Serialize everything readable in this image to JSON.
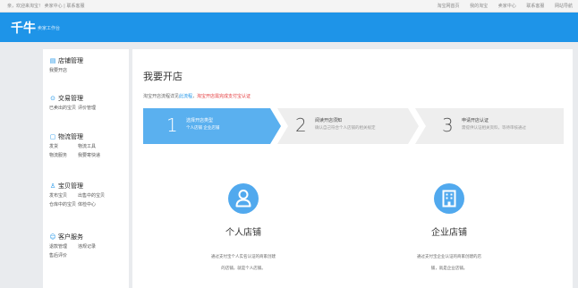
{
  "topbar": {
    "left": "亲，欢迎来淘宝！ 卖家中心 | 联系客服",
    "right": [
      "淘宝网首页",
      "我的淘宝",
      "卖家中心",
      "联系客服",
      "网站导航"
    ]
  },
  "header": {
    "logo": "千牛",
    "subtitle": "卖家工作台",
    "bg_color": "#1e94e8"
  },
  "sidebar": {
    "sections": [
      {
        "icon": "shop-icon",
        "glyph": "▤",
        "title": "店铺管理",
        "items": [
          [
            "我要开店"
          ]
        ]
      },
      {
        "icon": "trade-icon",
        "glyph": "⊙",
        "title": "交易管理",
        "items": [
          [
            "已卖出的宝贝",
            "评价管理"
          ]
        ]
      },
      {
        "icon": "logistics-icon",
        "glyph": "▢",
        "title": "物流管理",
        "items": [
          [
            "发货",
            "物流工具"
          ],
          [
            "物流服务",
            "我要寄快递"
          ]
        ]
      },
      {
        "icon": "goods-icon",
        "glyph": "♙",
        "title": "宝贝管理",
        "items": [
          [
            "发布宝贝",
            "出售中的宝贝"
          ],
          [
            "仓库中的宝贝",
            "体检中心"
          ]
        ]
      },
      {
        "icon": "service-icon",
        "glyph": "☺",
        "title": "客户服务",
        "items": [
          [
            "退款管理",
            "违规记录"
          ],
          [
            "售后评价"
          ]
        ]
      }
    ]
  },
  "main": {
    "title": "我要开店",
    "notice_prefix": "淘宝开店流程详见",
    "notice_blue": "此流程",
    "notice_sep": "，",
    "notice_red": "淘宝开店需完成支付宝认证",
    "steps": [
      {
        "num": "1",
        "title": "选择开店类型",
        "desc": "个人店铺 企业店铺",
        "state": "active"
      },
      {
        "num": "2",
        "title": "阅读开店须知",
        "desc": "确认自己符合个人店铺的相关规定",
        "state": "inactive"
      },
      {
        "num": "3",
        "title": "申请开店认证",
        "desc": "需提供认证相关资料，等待审核通过",
        "state": "inactive"
      }
    ],
    "cards": [
      {
        "title": "个人店铺",
        "desc1": "通过支付宝个人实名认证的商家创建",
        "desc2": "的店铺，就是个人店铺。"
      },
      {
        "title": "企业店铺",
        "desc1": "通过支付宝企业认证的商家创建的店",
        "desc2": "铺，就是企业店铺。"
      }
    ]
  },
  "colors": {
    "accent": "#1e94e8",
    "active_step": "#5ab0ef",
    "inactive_step": "#eeeeee",
    "notice_red": "#e4393c"
  }
}
